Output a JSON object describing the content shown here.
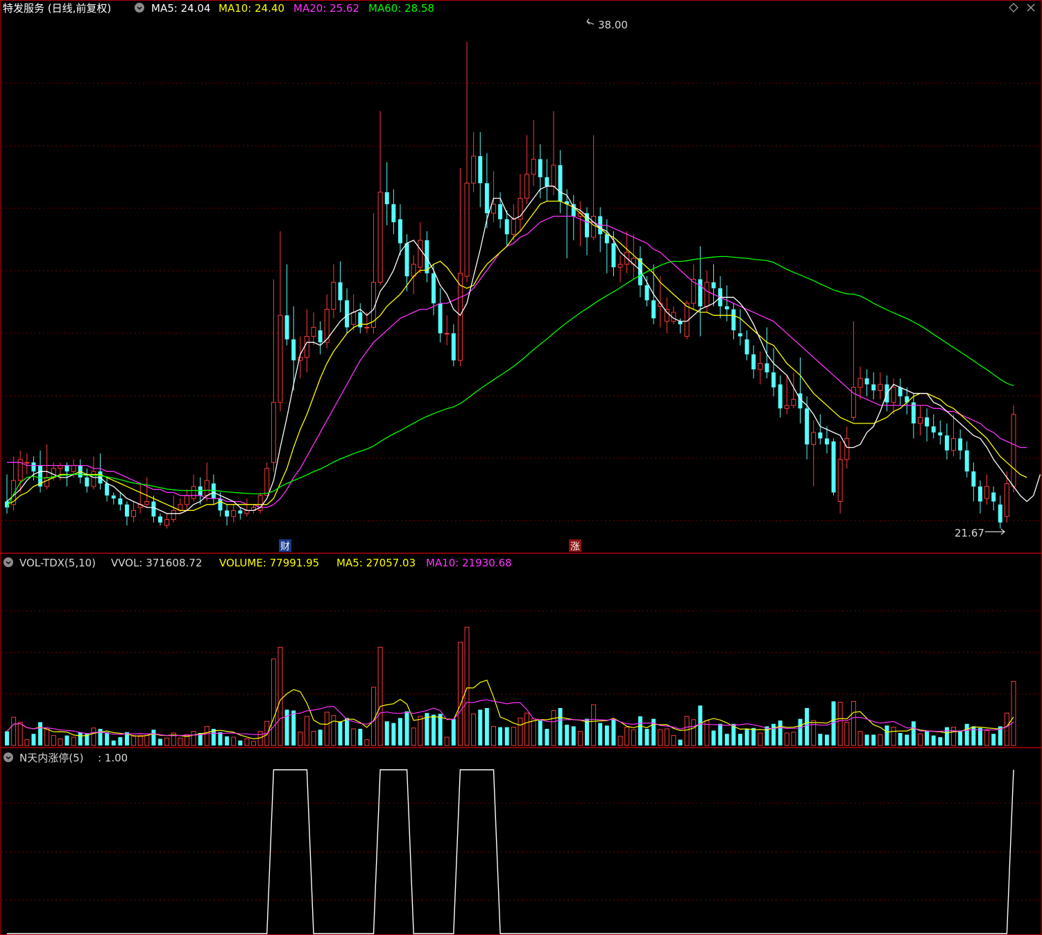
{
  "header": {
    "title": "特发服务 (日线,前复权)",
    "ma": [
      {
        "label": "MA5: 24.04",
        "color": "#ffffff"
      },
      {
        "label": "MA10: 24.40",
        "color": "#ffff00"
      },
      {
        "label": "MA20: 25.62",
        "color": "#ff33ff"
      },
      {
        "label": "MA60: 28.58",
        "color": "#00ff00"
      }
    ],
    "diamond_icon": "diamond-icon",
    "close_icon": "close-icon"
  },
  "price_panel": {
    "high_label": "38.00",
    "low_label": "21.67",
    "markers": [
      {
        "text": "财",
        "bg": "#1a3a8a",
        "index": 33
      },
      {
        "text": "涨",
        "bg": "#8a1010",
        "index": 68
      }
    ]
  },
  "volume_panel": {
    "title": "VOL-TDX(5,10)",
    "vvol": "VVOL: 371608.72",
    "volume": "VOLUME: 77991.95",
    "ma5": "MA5: 27057.03",
    "ma10": "MA10: 21930.68"
  },
  "limit_panel": {
    "title": "N天内涨停(5)",
    "value": ": 1.00"
  },
  "colors": {
    "up": "#ff3b3b",
    "down": "#54ffff",
    "grid": "#7a0000",
    "border": "#b40000"
  },
  "chart_data": {
    "type": "candlestick",
    "ylim": [
      21.0,
      38.8
    ],
    "candles": [
      [
        22.7,
        22.5,
        23.6,
        22.3
      ],
      [
        22.6,
        23.4,
        24.2,
        22.4
      ],
      [
        23.4,
        24.1,
        24.4,
        23.0
      ],
      [
        24.0,
        24.0,
        24.3,
        23.6
      ],
      [
        24.0,
        23.7,
        24.2,
        23.4
      ],
      [
        23.9,
        23.2,
        24.4,
        23.0
      ],
      [
        23.2,
        23.5,
        24.6,
        23.1
      ],
      [
        23.5,
        23.8,
        24.0,
        23.4
      ],
      [
        23.8,
        23.9,
        24.0,
        23.4
      ],
      [
        23.9,
        23.7,
        24.0,
        23.2
      ],
      [
        23.7,
        23.9,
        24.1,
        23.5
      ],
      [
        23.9,
        23.5,
        24.1,
        23.3
      ],
      [
        23.5,
        23.2,
        23.8,
        23.0
      ],
      [
        23.2,
        23.7,
        24.2,
        23.1
      ],
      [
        23.7,
        23.3,
        24.3,
        23.1
      ],
      [
        23.3,
        22.9,
        23.5,
        22.7
      ],
      [
        22.9,
        22.8,
        23.0,
        22.6
      ],
      [
        22.8,
        22.6,
        23.0,
        22.4
      ],
      [
        22.6,
        22.2,
        22.7,
        21.9
      ],
      [
        22.2,
        22.4,
        22.7,
        22.0
      ],
      [
        22.5,
        22.6,
        23.3,
        22.3
      ],
      [
        22.6,
        22.7,
        23.5,
        22.5
      ],
      [
        22.7,
        22.2,
        22.9,
        22.0
      ],
      [
        22.2,
        22.0,
        22.3,
        21.9
      ],
      [
        21.9,
        22.1,
        22.3,
        21.8
      ],
      [
        22.1,
        22.4,
        22.9,
        22.0
      ],
      [
        22.4,
        22.6,
        22.8,
        22.3
      ],
      [
        22.6,
        22.9,
        23.1,
        22.4
      ],
      [
        22.8,
        23.2,
        23.6,
        22.7
      ],
      [
        23.2,
        22.9,
        23.5,
        22.6
      ],
      [
        22.9,
        23.4,
        24.0,
        22.7
      ],
      [
        23.3,
        22.8,
        23.6,
        22.6
      ],
      [
        22.8,
        22.4,
        23.0,
        22.2
      ],
      [
        22.4,
        22.2,
        22.6,
        21.9
      ],
      [
        22.2,
        22.4,
        22.6,
        22.0
      ],
      [
        22.4,
        22.3,
        22.5,
        22.1
      ],
      [
        22.3,
        22.4,
        22.8,
        22.2
      ],
      [
        22.4,
        22.5,
        22.6,
        22.3
      ],
      [
        22.4,
        22.9,
        23.0,
        22.3
      ],
      [
        22.9,
        23.8,
        24.0,
        22.9
      ],
      [
        24.0,
        26.0,
        30.1,
        23.7
      ],
      [
        26.0,
        28.9,
        31.7,
        25.7
      ],
      [
        28.9,
        28.1,
        30.6,
        27.9
      ],
      [
        28.1,
        27.4,
        29.2,
        26.4
      ],
      [
        27.4,
        27.5,
        28.2,
        26.8
      ],
      [
        27.5,
        28.2,
        29.1,
        27.0
      ],
      [
        28.2,
        28.5,
        29.0,
        27.9
      ],
      [
        28.4,
        28.0,
        28.7,
        27.6
      ],
      [
        28.0,
        29.1,
        29.6,
        27.8
      ],
      [
        29.1,
        30.0,
        30.6,
        28.8
      ],
      [
        30.0,
        29.4,
        30.7,
        29.0
      ],
      [
        29.4,
        28.5,
        29.8,
        28.3
      ],
      [
        28.6,
        29.0,
        29.6,
        28.4
      ],
      [
        29.0,
        28.5,
        29.3,
        28.3
      ],
      [
        28.5,
        28.5,
        29.0,
        28.3
      ],
      [
        28.5,
        30.0,
        32.3,
        28.3
      ],
      [
        30.0,
        33.0,
        35.7,
        29.9
      ],
      [
        33.0,
        32.6,
        34.0,
        31.9
      ],
      [
        32.6,
        32.0,
        33.1,
        31.6
      ],
      [
        32.1,
        31.3,
        32.6,
        30.9
      ],
      [
        31.3,
        30.2,
        31.6,
        29.7
      ],
      [
        30.2,
        30.6,
        30.9,
        29.6
      ],
      [
        30.5,
        31.4,
        32.0,
        30.3
      ],
      [
        31.4,
        30.3,
        31.7,
        30.0
      ],
      [
        30.3,
        29.3,
        30.6,
        28.9
      ],
      [
        29.3,
        28.3,
        29.8,
        28.0
      ],
      [
        28.3,
        28.3,
        28.9,
        27.9
      ],
      [
        28.3,
        27.4,
        28.6,
        27.2
      ],
      [
        27.4,
        30.3,
        33.8,
        27.2
      ],
      [
        30.2,
        33.3,
        38.0,
        30.0
      ],
      [
        33.3,
        34.2,
        35.0,
        33.0
      ],
      [
        34.2,
        33.3,
        35.0,
        32.5
      ],
      [
        33.3,
        32.3,
        34.3,
        31.8
      ],
      [
        32.3,
        32.6,
        33.7,
        32.0
      ],
      [
        32.6,
        32.1,
        33.0,
        31.8
      ],
      [
        32.1,
        31.6,
        32.4,
        31.2
      ],
      [
        31.6,
        32.1,
        32.6,
        31.4
      ],
      [
        32.1,
        32.8,
        33.6,
        31.7
      ],
      [
        32.8,
        33.6,
        34.9,
        32.6
      ],
      [
        33.6,
        34.1,
        35.4,
        33.2
      ],
      [
        34.1,
        33.5,
        34.6,
        32.8
      ],
      [
        33.5,
        33.2,
        34.1,
        32.7
      ],
      [
        33.2,
        33.9,
        35.7,
        32.9
      ],
      [
        33.9,
        32.7,
        34.4,
        32.3
      ],
      [
        32.7,
        32.6,
        33.1,
        30.8
      ],
      [
        32.6,
        32.2,
        32.9,
        31.4
      ],
      [
        32.2,
        32.3,
        32.7,
        31.2
      ],
      [
        32.3,
        31.5,
        32.5,
        30.9
      ],
      [
        31.5,
        32.2,
        34.9,
        31.4
      ],
      [
        32.2,
        31.6,
        32.5,
        31.0
      ],
      [
        31.6,
        31.3,
        32.1,
        30.3
      ],
      [
        31.3,
        30.5,
        31.7,
        30.2
      ],
      [
        30.5,
        30.6,
        30.9,
        30.0
      ],
      [
        30.6,
        31.0,
        31.7,
        30.3
      ],
      [
        30.6,
        30.8,
        31.6,
        30.1
      ],
      [
        30.8,
        29.9,
        31.2,
        29.5
      ],
      [
        29.9,
        29.4,
        30.2,
        29.2
      ],
      [
        29.4,
        28.8,
        30.6,
        28.6
      ],
      [
        29.2,
        29.3,
        30.2,
        28.5
      ],
      [
        28.7,
        29.1,
        29.5,
        28.3
      ],
      [
        28.7,
        29.0,
        29.2,
        28.6
      ],
      [
        28.7,
        28.6,
        28.8,
        28.3
      ],
      [
        28.2,
        29.3,
        29.4,
        28.1
      ],
      [
        29.3,
        30.1,
        30.6,
        29.1
      ],
      [
        30.1,
        29.2,
        31.2,
        28.2
      ],
      [
        29.2,
        30.0,
        30.4,
        29.0
      ],
      [
        30.0,
        29.8,
        30.6,
        29.2
      ],
      [
        29.8,
        29.2,
        30.2,
        28.8
      ],
      [
        29.2,
        29.1,
        29.9,
        28.7
      ],
      [
        29.1,
        28.4,
        29.3,
        28.1
      ],
      [
        28.3,
        28.2,
        29.1,
        27.9
      ],
      [
        28.1,
        27.6,
        28.4,
        27.4
      ],
      [
        27.6,
        27.1,
        27.9,
        26.8
      ],
      [
        27.1,
        27.3,
        27.7,
        26.6
      ],
      [
        27.3,
        27.0,
        28.5,
        26.8
      ],
      [
        27.0,
        26.5,
        27.8,
        26.2
      ],
      [
        26.6,
        25.8,
        26.9,
        25.5
      ],
      [
        25.8,
        25.9,
        26.9,
        25.6
      ],
      [
        25.9,
        26.1,
        27.0,
        25.8
      ],
      [
        26.3,
        25.8,
        27.5,
        25.3
      ],
      [
        25.8,
        24.6,
        26.2,
        24.1
      ],
      [
        24.6,
        25.0,
        25.4,
        23.2
      ],
      [
        25.0,
        24.8,
        25.6,
        24.6
      ],
      [
        24.8,
        24.6,
        25.2,
        24.3
      ],
      [
        24.7,
        23.0,
        24.8,
        22.9
      ],
      [
        22.7,
        24.1,
        24.7,
        22.3
      ],
      [
        24.1,
        24.8,
        25.2,
        23.8
      ],
      [
        25.5,
        26.5,
        28.7,
        25.4
      ],
      [
        26.5,
        26.8,
        27.2,
        26.1
      ],
      [
        26.8,
        26.6,
        27.1,
        26.2
      ],
      [
        26.6,
        26.4,
        27.0,
        26.1
      ],
      [
        26.4,
        26.6,
        27.0,
        26.1
      ],
      [
        26.6,
        26.0,
        26.9,
        25.7
      ],
      [
        26.0,
        26.5,
        26.8,
        25.6
      ],
      [
        26.5,
        26.2,
        26.8,
        25.9
      ],
      [
        26.2,
        26.0,
        26.5,
        25.6
      ],
      [
        26.0,
        25.3,
        26.3,
        24.8
      ],
      [
        25.3,
        25.5,
        25.9,
        24.9
      ],
      [
        25.5,
        25.2,
        25.8,
        24.7
      ],
      [
        25.2,
        25.0,
        25.6,
        24.8
      ],
      [
        25.0,
        24.9,
        25.4,
        24.6
      ],
      [
        24.9,
        24.4,
        25.3,
        24.1
      ],
      [
        24.4,
        24.8,
        25.6,
        24.2
      ],
      [
        24.8,
        24.4,
        25.1,
        24.1
      ],
      [
        24.4,
        23.7,
        24.7,
        23.5
      ],
      [
        23.7,
        23.2,
        24.0,
        22.7
      ],
      [
        23.2,
        22.7,
        23.4,
        22.3
      ],
      [
        22.8,
        23.2,
        23.6,
        22.6
      ],
      [
        23.0,
        22.7,
        23.2,
        22.4
      ],
      [
        22.6,
        22.0,
        22.9,
        21.8
      ],
      [
        22.2,
        23.3,
        23.7,
        22.0
      ],
      [
        23.2,
        25.6,
        25.9,
        23.0
      ]
    ],
    "ma5": [
      22.7,
      22.9,
      23.1,
      23.4,
      23.6,
      23.7,
      23.7,
      23.6,
      23.5,
      23.5,
      23.6,
      23.6,
      23.6,
      23.5,
      23.5,
      23.3,
      23.2,
      23.0,
      22.8,
      22.7,
      22.6,
      22.5,
      22.5,
      22.4,
      22.3,
      22.3,
      22.3,
      22.4,
      22.6,
      22.7,
      22.9,
      23.0,
      22.9,
      22.8,
      22.7,
      22.5,
      22.4,
      22.4,
      22.5,
      22.8,
      23.4,
      24.5,
      25.5,
      26.6,
      27.6,
      28.0,
      28.0,
      27.9,
      28.1,
      28.4,
      28.7,
      28.9,
      29.0,
      29.1,
      28.9,
      29.1,
      29.7,
      30.0,
      30.4,
      31.0,
      31.3,
      31.4,
      31.1,
      30.8,
      30.4,
      29.9,
      29.6,
      29.1,
      28.9,
      29.3,
      30.2,
      31.1,
      32.1,
      32.8,
      32.8,
      32.3,
      32.1,
      32.2,
      32.5,
      32.8,
      33.1,
      33.2,
      33.2,
      33.0,
      32.9,
      32.5,
      32.4,
      32.2,
      32.0,
      31.8,
      31.7,
      31.4,
      31.0,
      30.8,
      30.6,
      30.4,
      30.0,
      29.6,
      29.3,
      29.0,
      28.8,
      28.7,
      28.7,
      28.9,
      29.1,
      29.2,
      29.3,
      29.5,
      29.5,
      29.5,
      29.3,
      29.0,
      28.6,
      28.1,
      27.6,
      27.3,
      27.1,
      26.9,
      26.5,
      26.1,
      25.9,
      25.6,
      25.2,
      25.1,
      25.0,
      24.9,
      24.5,
      24.5,
      24.6,
      25.0,
      25.2,
      25.7,
      26.3,
      26.6,
      26.5,
      26.4,
      26.3,
      26.3,
      26.3,
      26.0,
      25.9,
      25.7,
      25.5,
      25.3,
      25.1,
      24.9,
      24.8,
      24.5,
      24.1,
      23.8,
      23.5,
      23.2,
      22.9,
      22.7,
      22.9,
      23.6
    ],
    "ma10": [
      22.6,
      22.7,
      22.9,
      23.0,
      23.2,
      23.3,
      23.4,
      23.5,
      23.6,
      23.6,
      23.6,
      23.7,
      23.6,
      23.6,
      23.6,
      23.5,
      23.4,
      23.3,
      23.2,
      23.1,
      23.0,
      22.9,
      22.8,
      22.7,
      22.6,
      22.5,
      22.4,
      22.4,
      22.4,
      22.5,
      22.6,
      22.6,
      22.7,
      22.6,
      22.6,
      22.6,
      22.6,
      22.6,
      22.6,
      22.6,
      22.8,
      23.3,
      23.8,
      24.5,
      25.1,
      25.6,
      26.2,
      26.8,
      27.3,
      27.7,
      28.0,
      28.3,
      28.5,
      28.6,
      28.6,
      28.7,
      28.9,
      29.2,
      29.4,
      29.6,
      29.9,
      30.2,
      30.4,
      30.4,
      30.6,
      30.7,
      30.5,
      30.2,
      29.9,
      29.8,
      29.9,
      30.3,
      30.6,
      30.8,
      31.0,
      31.2,
      31.5,
      31.7,
      32.0,
      32.3,
      32.6,
      32.7,
      32.7,
      32.7,
      32.6,
      32.5,
      32.3,
      32.1,
      31.9,
      31.8,
      31.6,
      31.5,
      31.3,
      31.1,
      30.9,
      30.7,
      30.5,
      30.3,
      30.0,
      29.8,
      29.6,
      29.4,
      29.2,
      29.1,
      29.0,
      29.0,
      28.9,
      28.9,
      28.9,
      28.9,
      28.8,
      28.6,
      28.4,
      28.2,
      28.0,
      27.9,
      27.6,
      27.3,
      27.1,
      26.9,
      26.6,
      26.3,
      26.1,
      25.9,
      25.7,
      25.5,
      25.4,
      25.3,
      25.3,
      25.3,
      25.3,
      25.4,
      25.5,
      25.7,
      25.8,
      26.0,
      26.2,
      26.3,
      26.3,
      26.2,
      26.1,
      25.9,
      25.8,
      25.6,
      25.4,
      25.2,
      25.0,
      24.8,
      24.5,
      24.2,
      24.0,
      23.8,
      23.6,
      23.5
    ],
    "ma20": [
      24.0,
      24.0,
      24.0,
      23.9,
      23.9,
      23.9,
      23.9,
      23.9,
      23.9,
      23.9,
      23.9,
      23.9,
      23.9,
      23.8,
      23.8,
      23.7,
      23.7,
      23.6,
      23.5,
      23.4,
      23.3,
      23.2,
      23.1,
      23.1,
      23.0,
      23.0,
      22.9,
      22.9,
      22.9,
      22.9,
      22.8,
      22.8,
      22.8,
      22.7,
      22.7,
      22.7,
      22.6,
      22.6,
      22.5,
      22.5,
      22.6,
      22.8,
      23.1,
      23.5,
      23.8,
      24.2,
      24.6,
      25.0,
      25.4,
      25.8,
      26.2,
      26.6,
      27.0,
      27.4,
      27.7,
      28.0,
      28.2,
      28.4,
      28.6,
      28.8,
      28.9,
      29.0,
      29.1,
      29.1,
      29.2,
      29.3,
      29.3,
      29.4,
      29.5,
      29.6,
      29.8,
      30.1,
      30.4,
      30.7,
      31.0,
      31.2,
      31.3,
      31.5,
      31.6,
      31.8,
      32.0,
      32.1,
      32.2,
      32.2,
      32.2,
      32.2,
      32.1,
      32.0,
      32.0,
      31.9,
      31.9,
      31.8,
      31.7,
      31.6,
      31.5,
      31.4,
      31.3,
      31.1,
      31.0,
      30.8,
      30.6,
      30.4,
      30.2,
      30.0,
      29.9,
      29.7,
      29.6,
      29.5,
      29.4,
      29.3,
      29.2,
      29.1,
      29.0,
      28.9,
      28.8,
      28.7,
      28.5,
      28.3,
      28.1,
      27.9,
      27.7,
      27.5,
      27.3,
      27.1,
      26.9,
      26.7,
      26.5,
      26.3,
      26.2,
      26.1,
      26.0,
      25.9,
      25.9,
      25.9,
      25.9,
      25.9,
      25.9,
      25.9,
      25.9,
      25.8,
      25.8,
      25.7,
      25.7,
      25.6,
      25.5,
      25.4,
      25.3,
      25.1,
      25.0,
      24.8,
      24.7,
      24.6,
      24.5,
      24.5
    ]
  }
}
